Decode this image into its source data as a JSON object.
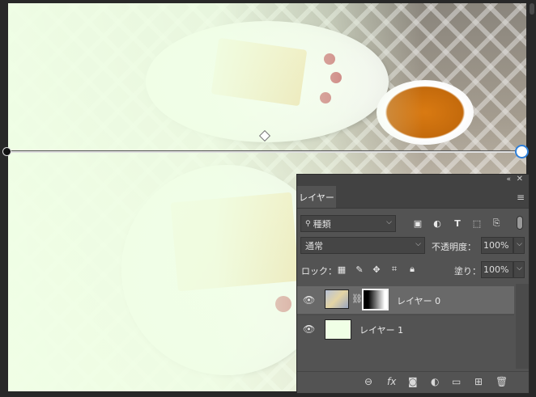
{
  "panel": {
    "collapse_icon": "«",
    "close_icon": "✕",
    "tab_label": "レイヤー",
    "menu_icon": "≡"
  },
  "filter": {
    "search_icon": "🔍",
    "kind_label": "種類"
  },
  "blend": {
    "mode": "通常",
    "opacity_label": "不透明度：",
    "opacity_value": "100%"
  },
  "lock": {
    "label": "ロック：",
    "fill_label": "塗り：",
    "fill_value": "100%"
  },
  "layers": [
    {
      "name": "レイヤー 0",
      "selected": true,
      "has_mask": true
    },
    {
      "name": "レイヤー 1",
      "selected": false,
      "has_mask": false
    }
  ],
  "bottom_icons": [
    "link-icon",
    "fx-icon",
    "mask-icon",
    "adjustment-icon",
    "folder-icon",
    "new-layer-icon",
    "trash-icon"
  ],
  "bottom_labels": {
    "fx": "fx"
  },
  "colors": {
    "panel_bg": "#535353",
    "selected_layer": "#696969",
    "gradient_handle": "#2f7fd8",
    "fade_overlay": "#f0ffe6"
  }
}
